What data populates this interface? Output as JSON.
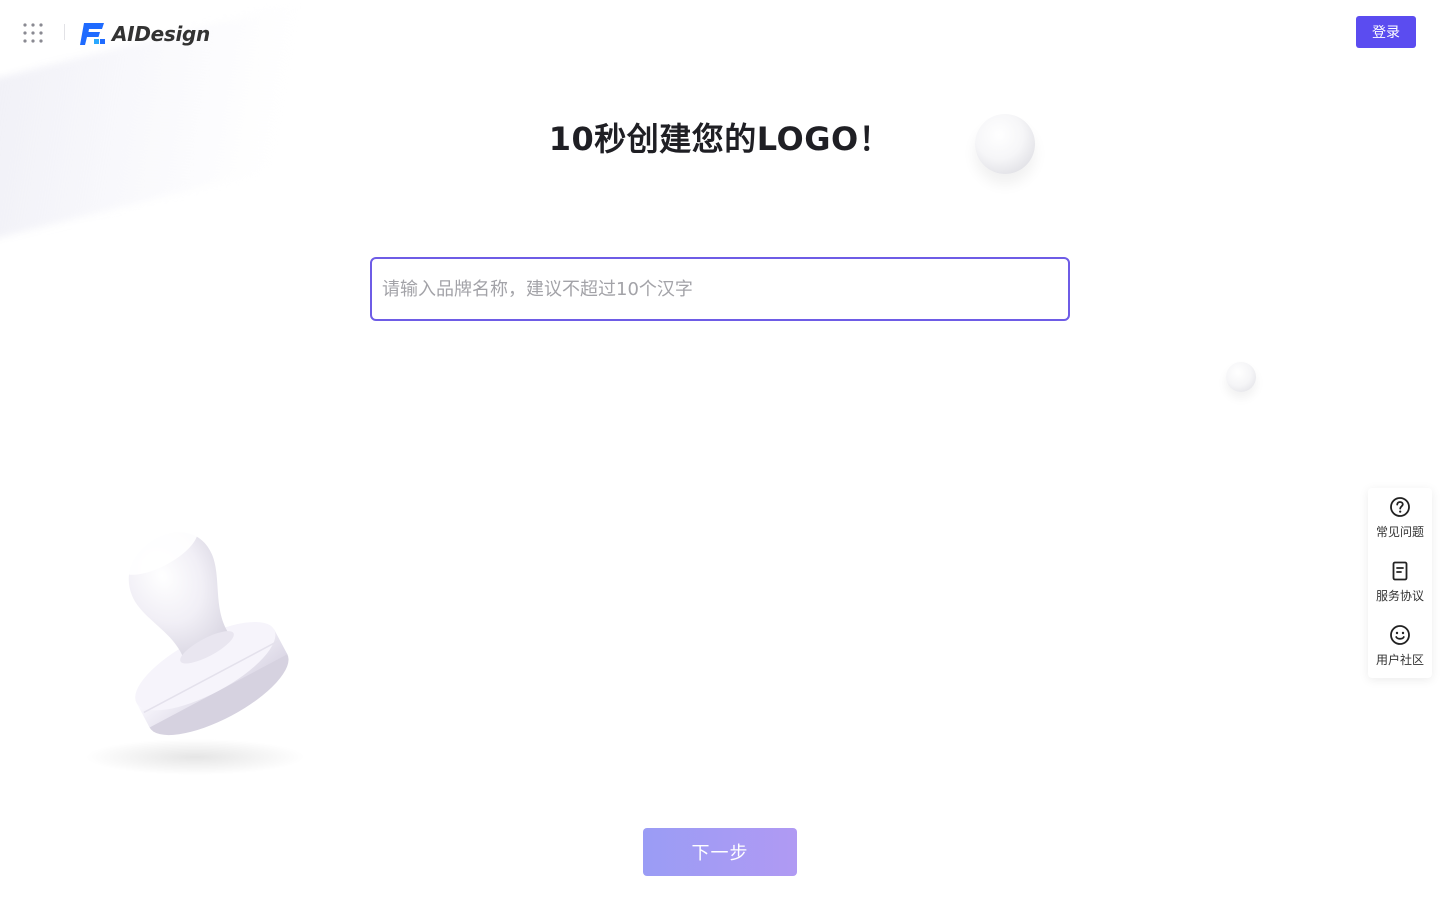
{
  "header": {
    "apps_icon": "apps-grid-icon",
    "logo_text": "AIDesign",
    "logo_colors": {
      "primary": "#1f6bff",
      "secondary": "#2aa8ff"
    },
    "login_label": "登录"
  },
  "main": {
    "headline": "10秒创建您的LOGO！",
    "brand_input": {
      "value": "",
      "placeholder": "请输入品牌名称，建议不超过10个汉字"
    },
    "next_label": "下一步"
  },
  "side_tools": [
    {
      "label": "常见问题",
      "icon": "question-circle-icon"
    },
    {
      "label": "服务协议",
      "icon": "document-icon"
    },
    {
      "label": "用户社区",
      "icon": "smile-face-icon"
    }
  ],
  "colors": {
    "accent": "#5b4cf0",
    "input_border": "#6e5ce6",
    "next_button_start": "#9a9cf5",
    "next_button_end": "#b09af3"
  }
}
